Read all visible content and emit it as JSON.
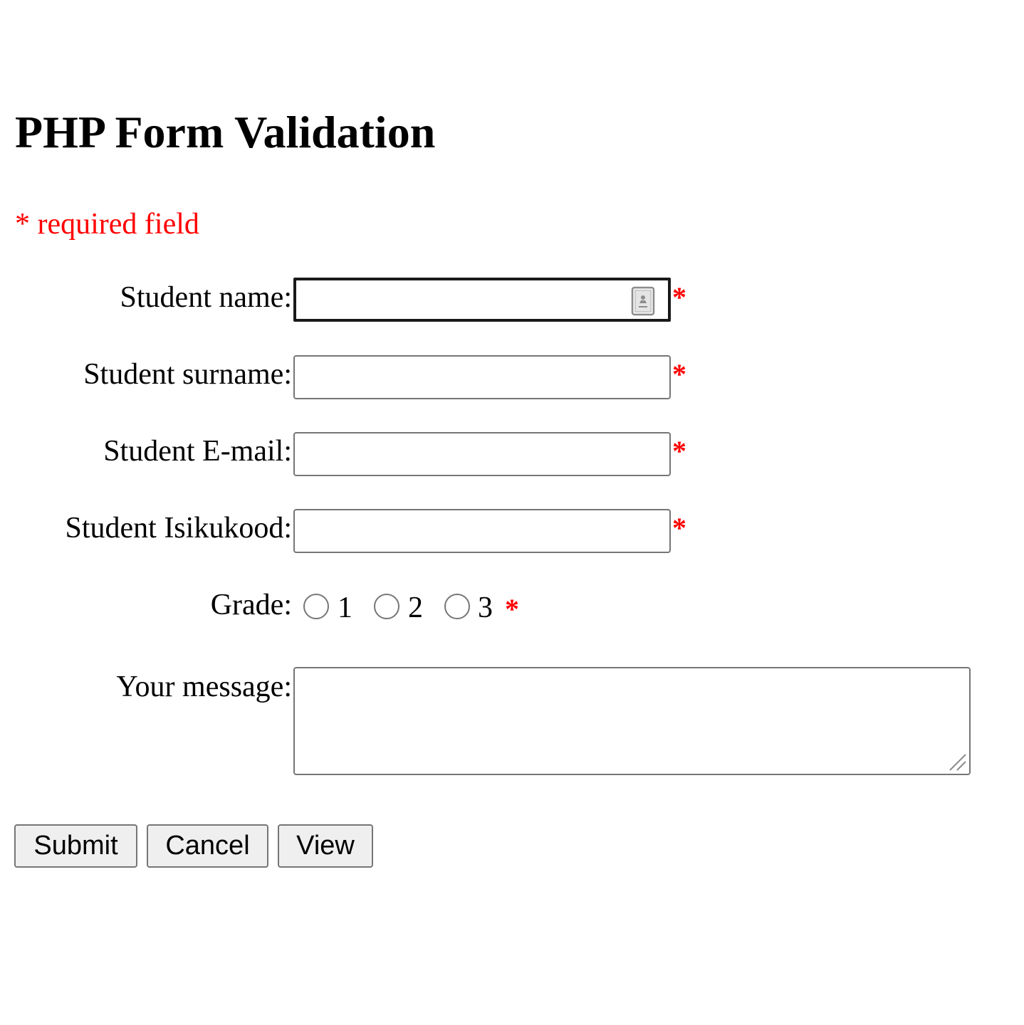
{
  "page": {
    "title": "PHP Form Validation",
    "required_note": "* required field"
  },
  "form": {
    "required_marker": "*",
    "fields": [
      {
        "label": "Student name:",
        "value": "",
        "placeholder": "",
        "focused": true,
        "has_autofill_icon": true
      },
      {
        "label": "Student surname:",
        "value": "",
        "placeholder": ""
      },
      {
        "label": "Student E-mail:",
        "value": "",
        "placeholder": ""
      },
      {
        "label": "Student Isikukood:",
        "value": "",
        "placeholder": ""
      }
    ],
    "grade": {
      "label": "Grade:",
      "options": [
        "1",
        "2",
        "3"
      ],
      "selected": null
    },
    "message": {
      "label": "Your message:",
      "value": ""
    },
    "buttons": {
      "submit": "Submit",
      "cancel": "Cancel",
      "view": "View"
    }
  },
  "colors": {
    "required": "#ff0000",
    "input_border": "#767676",
    "focused_border": "#1a1a1a",
    "button_bg": "#efefef"
  },
  "icons": {
    "autofill": "contact-card-icon",
    "resize": "resize-grip-icon"
  }
}
